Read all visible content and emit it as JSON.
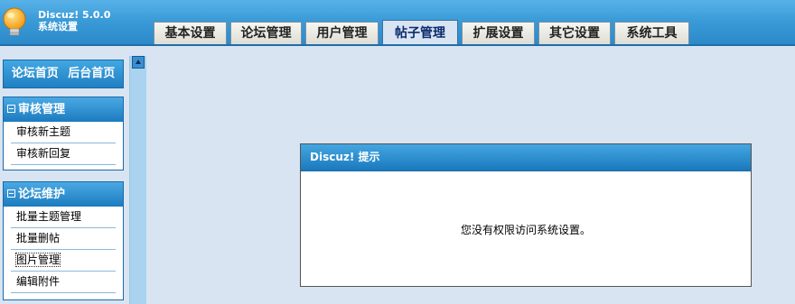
{
  "app": {
    "product": "Discuz! 5.0.0",
    "subtitle": "系统设置"
  },
  "tabs": [
    {
      "label": "基本设置",
      "active": false
    },
    {
      "label": "论坛管理",
      "active": false
    },
    {
      "label": "用户管理",
      "active": false
    },
    {
      "label": "帖子管理",
      "active": true
    },
    {
      "label": "扩展设置",
      "active": false
    },
    {
      "label": "其它设置",
      "active": false
    },
    {
      "label": "系统工具",
      "active": false
    }
  ],
  "sidebar": {
    "home_links": [
      "论坛首页",
      "后台首页"
    ],
    "sections": [
      {
        "title": "审核管理",
        "items": [
          "审核新主题",
          "审核新回复"
        ]
      },
      {
        "title": "论坛维护",
        "items": [
          "批量主题管理",
          "批量删帖",
          "图片管理",
          "编辑附件"
        ]
      }
    ]
  },
  "dialog": {
    "title": "Discuz! 提示",
    "message": "您没有权限访问系统设置。"
  },
  "colors": {
    "header_blue": "#3a9bd8",
    "page_bg": "#d8e4f2",
    "active_tab_text": "#0a2a6e"
  }
}
